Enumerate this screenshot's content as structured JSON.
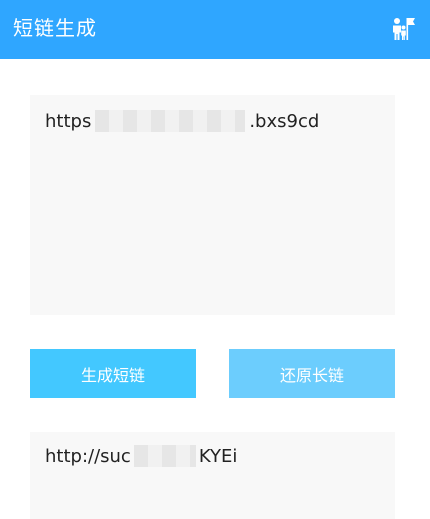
{
  "app_bar": {
    "title": "短链生成",
    "action_icon": "family-icon",
    "background_color": "#2fa6ff"
  },
  "input": {
    "text_prefix": "https",
    "text_suffix": ".bxs9cd"
  },
  "buttons": {
    "generate_label": "生成短链",
    "restore_label": "还原长链",
    "generate_color": "#43c8ff",
    "restore_color": "#6ccdfd"
  },
  "output": {
    "text_prefix": "http://suc",
    "text_suffix": "KYEi"
  }
}
